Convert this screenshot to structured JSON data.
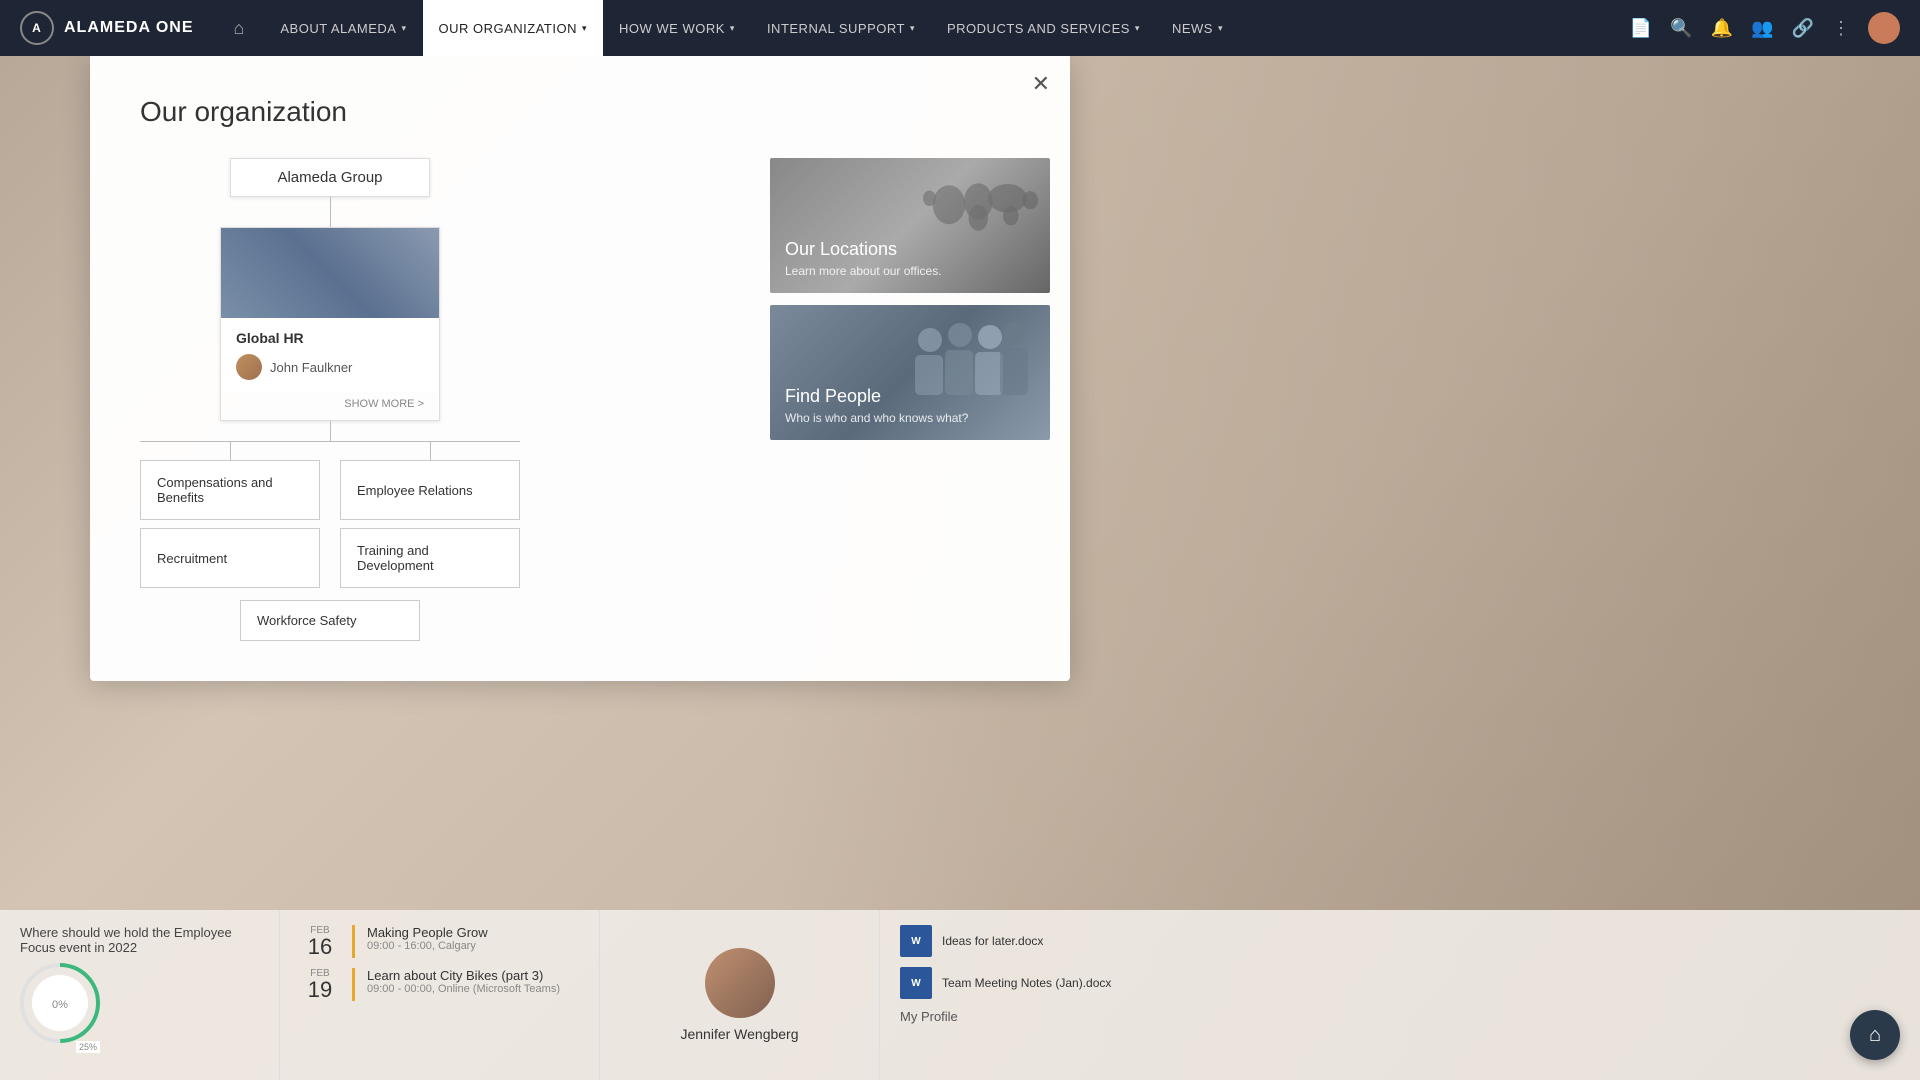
{
  "app": {
    "name": "ALAMEDA ONE"
  },
  "nav": {
    "home_icon": "⌂",
    "items": [
      {
        "label": "ABOUT ALAMEDA",
        "active": false,
        "has_caret": true
      },
      {
        "label": "OUR ORGANIZATION",
        "active": true,
        "has_caret": true
      },
      {
        "label": "HOW WE WORK",
        "active": false,
        "has_caret": true
      },
      {
        "label": "INTERNAL SUPPORT",
        "active": false,
        "has_caret": true
      },
      {
        "label": "PRODUCTS AND SERVICES",
        "active": false,
        "has_caret": true
      },
      {
        "label": "NEWS",
        "active": false,
        "has_caret": true
      }
    ],
    "icons": [
      "📄",
      "🔍",
      "🔔",
      "👥",
      "🔗",
      "⋮"
    ]
  },
  "dropdown": {
    "title": "Our organization",
    "close_label": "✕",
    "top_node": "Alameda Group",
    "card": {
      "title": "Global HR",
      "person_name": "John Faulkner",
      "show_more": "SHOW MORE >"
    },
    "children": [
      {
        "label": "Compensations and Benefits"
      },
      {
        "label": "Employee Relations"
      },
      {
        "label": "Recruitment"
      },
      {
        "label": "Training and Development"
      }
    ],
    "bottom_node": "Workforce Safety",
    "right_cards": [
      {
        "title": "Our Locations",
        "subtitle": "Learn more about our offices."
      },
      {
        "title": "Find People",
        "subtitle": "Who is who and who knows what?"
      }
    ]
  },
  "bottom": {
    "poll": {
      "title": "Where should we hold the Employee Focus event in 2022"
    },
    "events": [
      {
        "month": "FEB",
        "day": "16",
        "name": "Making People Grow",
        "time": "09:00 - 16:00, Calgary",
        "has_bar": true
      },
      {
        "month": "FEB",
        "day": "19",
        "name": "Learn about City Bikes (part 3)",
        "time": "09:00 - 00:00, Online (Microsoft Teams)",
        "has_bar": true
      }
    ],
    "person": {
      "name": "Jennifer Wengberg"
    },
    "docs": [
      {
        "name": "Ideas for later.docx"
      },
      {
        "name": "Team Meeting Notes (Jan).docx"
      }
    ],
    "my_profile": "My Profile"
  }
}
